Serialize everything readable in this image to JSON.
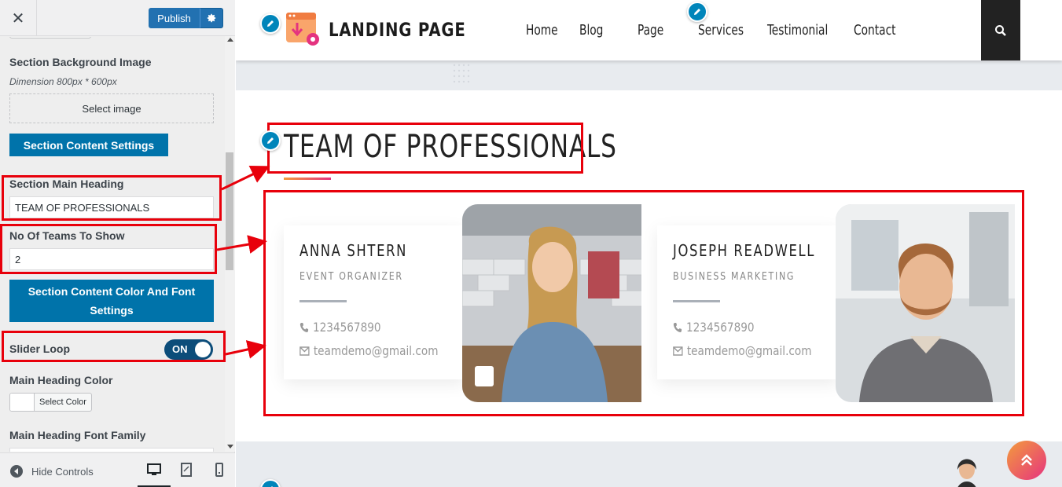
{
  "customizer": {
    "close_label": "✕",
    "publish_label": "Publish",
    "bg_image_label": "Section Background Image",
    "bg_image_desc": "Dimension 800px * 600px",
    "select_image_label": "Select image",
    "content_settings_label": "Section Content Settings",
    "main_heading_label": "Section Main Heading",
    "main_heading_value": "TEAM OF PROFESSIONALS",
    "teams_count_label": "No Of Teams To Show",
    "teams_count_value": "2",
    "color_font_settings_label": "Section Content Color And Font Settings",
    "slider_loop_label": "Slider Loop",
    "slider_loop_state": "ON",
    "heading_color_label": "Main Heading Color",
    "select_color_label": "Select Color",
    "heading_font_label": "Main Heading Font Family",
    "hide_controls_label": "Hide Controls"
  },
  "site": {
    "brand": "LANDING PAGE",
    "nav": [
      "Home",
      "Blog",
      "Page",
      "Services",
      "Testimonial",
      "Contact"
    ],
    "section_heading": "TEAM OF PROFESSIONALS",
    "team": [
      {
        "name": "ANNA SHTERN",
        "role": "EVENT ORGANIZER",
        "phone": "1234567890",
        "email": "teamdemo@gmail.com"
      },
      {
        "name": "JOSEPH READWELL",
        "role": "BUSINESS MARKETING",
        "phone": "1234567890",
        "email": "teamdemo@gmail.com"
      }
    ]
  },
  "colors": {
    "publish_blue": "#2271b1",
    "section_button_blue": "#0073aa",
    "annotation_red": "#e8000b",
    "accent_gradient_start": "#f39c3c",
    "accent_gradient_end": "#e6337f"
  },
  "icons": [
    "close-icon",
    "gear-icon",
    "pencil-icon",
    "search-icon",
    "phone-icon",
    "envelope-icon",
    "chevron-up-icon",
    "desktop-icon",
    "tablet-icon",
    "mobile-icon",
    "hide-controls-icon"
  ]
}
